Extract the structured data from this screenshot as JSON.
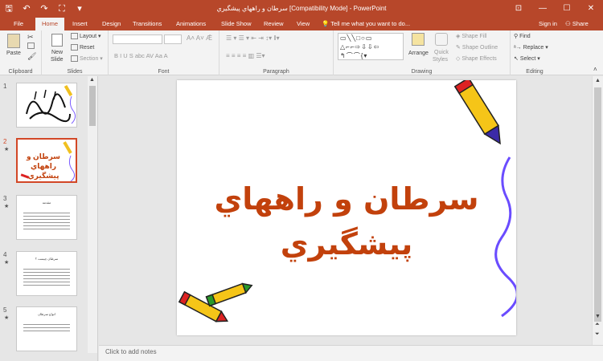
{
  "window": {
    "title": "سرطان و راههاي پيشگيري [Compatibility Mode] - PowerPoint",
    "controls": [
      "⊡",
      "—",
      "☐",
      "✕"
    ]
  },
  "qat": {
    "save": "🖫",
    "undo": "↶",
    "redo": "↷",
    "start": "⛶",
    "more": "▾"
  },
  "tabs": [
    "File",
    "Home",
    "Insert",
    "Design",
    "Transitions",
    "Animations",
    "Slide Show",
    "Review",
    "View"
  ],
  "tell_me": "Tell me what you want to do...",
  "sign_in": "Sign in",
  "share": "Share",
  "ribbon": {
    "clipboard": {
      "label": "Clipboard",
      "paste": "Paste"
    },
    "slides": {
      "label": "Slides",
      "new_slide": "New",
      "new_slide2": "Slide",
      "layout": "Layout",
      "reset": "Reset",
      "section": "Section"
    },
    "font": {
      "label": "Font",
      "buttons": "B  I  U  S  abc  AV   Aa   A"
    },
    "paragraph": {
      "label": "Paragraph"
    },
    "drawing": {
      "label": "Drawing",
      "arrange": "Arrange",
      "quick_styles": "Quick",
      "quick_styles2": "Styles",
      "shape_fill": "Shape Fill",
      "shape_outline": "Shape Outline",
      "shape_effects": "Shape Effects",
      "shapes_glyphs": "▭╲╲□○▭ △⌐⌐⇨⇩⇩⇦ ↰⌒⌒{▾"
    },
    "editing": {
      "label": "Editing",
      "find": "Find",
      "replace": "Replace",
      "select": "Select"
    }
  },
  "slides": [
    {
      "num": "1",
      "has_star": false,
      "selected": false,
      "title": "",
      "kind": "calligraphy"
    },
    {
      "num": "2",
      "has_star": true,
      "selected": true,
      "title": "سرطان و راههاي پيشگيري",
      "kind": "title"
    },
    {
      "num": "3",
      "has_star": true,
      "selected": false,
      "title": "مقدمه",
      "kind": "text"
    },
    {
      "num": "4",
      "has_star": true,
      "selected": false,
      "title": "سرطان چيست ؟",
      "kind": "text"
    },
    {
      "num": "5",
      "has_star": true,
      "selected": false,
      "title": "انواع سرطان",
      "kind": "text"
    }
  ],
  "slide": {
    "title_line1": "سرطان و راههاي",
    "title_line2": "پيشگيري"
  },
  "notes_placeholder": "Click to add notes",
  "colors": {
    "accent": "#b7472a",
    "title_text": "#c2410c",
    "selected_thumb_border": "#d24726"
  }
}
